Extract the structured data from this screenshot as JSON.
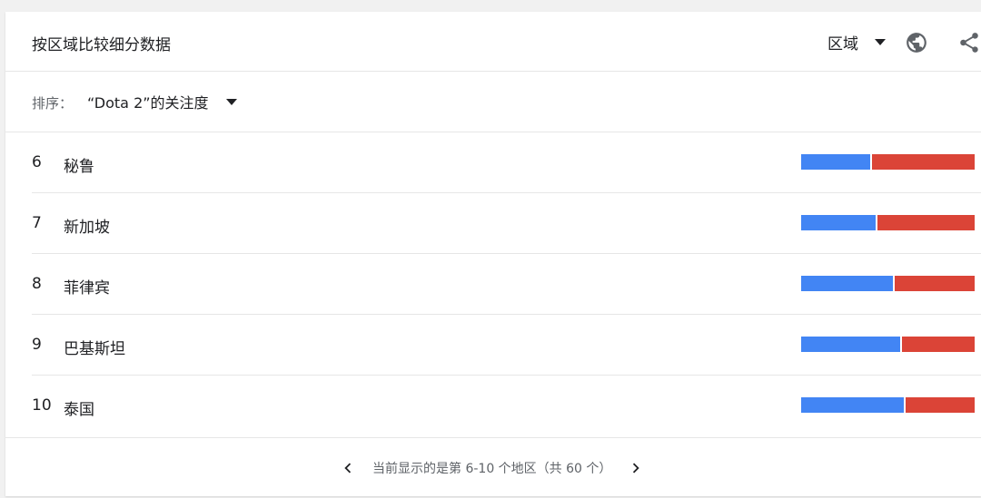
{
  "header": {
    "title": "按区域比较细分数据",
    "region_select": "区域",
    "globe_icon": "globe-icon",
    "share_icon": "share-icon"
  },
  "sort": {
    "label": "排序：",
    "value": "“Dota 2”的关注度"
  },
  "rows": [
    {
      "rank": "6",
      "name": "秘鲁",
      "share_a": 0.4
    },
    {
      "rank": "7",
      "name": "新加坡",
      "share_a": 0.43
    },
    {
      "rank": "8",
      "name": "菲律宾",
      "share_a": 0.53
    },
    {
      "rank": "9",
      "name": "巴基斯坦",
      "share_a": 0.57
    },
    {
      "rank": "10",
      "name": "泰国",
      "share_a": 0.59
    }
  ],
  "footer": {
    "pager_text": "当前显示的是第 6-10 个地区（共 60 个）"
  },
  "colors": {
    "series_a": "#4285f4",
    "series_b": "#db4437"
  }
}
